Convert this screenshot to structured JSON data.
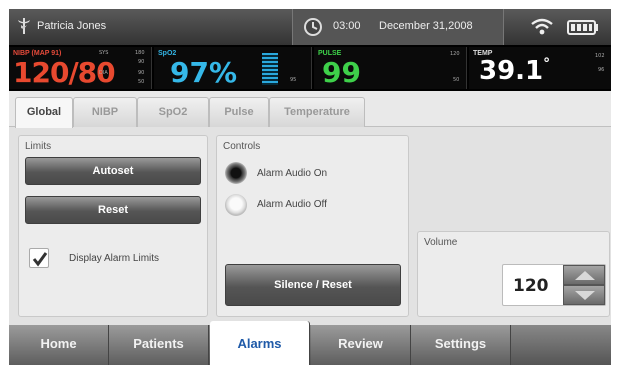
{
  "status_bar": {
    "patient_name": "Patricia Jones",
    "time": "03:00",
    "date": "December 31,2008",
    "icons": [
      "caduceus-icon",
      "clock-icon",
      "wifi-icon",
      "battery-icon"
    ]
  },
  "vitals": {
    "nibp": {
      "label": "NIBP (MAP 91)",
      "value": "120/80",
      "sys": "SYS",
      "dia": "DIA",
      "sys_hi": "180",
      "sys_lo": "90",
      "dia_hi": "90",
      "dia_lo": "50"
    },
    "spo2": {
      "label": "SpO2",
      "value": "97%",
      "limit_low": "95"
    },
    "pulse": {
      "label": "PULSE",
      "value": "99",
      "limit_high": "120",
      "limit_low": "50"
    },
    "temp": {
      "label": "TEMP",
      "value": "39.1",
      "unit": "°",
      "limit_high": "102",
      "limit_low": "96"
    },
    "colors": {
      "nibp": "#e8492f",
      "spo2": "#35b8e8",
      "pulse": "#3ed04a",
      "temp": "#ffffff"
    }
  },
  "tabs": [
    {
      "label": "Global",
      "active": true
    },
    {
      "label": "NIBP"
    },
    {
      "label": "SpO2"
    },
    {
      "label": "Pulse"
    },
    {
      "label": "Temperature"
    }
  ],
  "limits": {
    "title": "Limits",
    "autoset_label": "Autoset",
    "reset_label": "Reset",
    "display_alarm_limits_label": "Display Alarm Limits",
    "display_alarm_limits_checked": true
  },
  "controls": {
    "title": "Controls",
    "alarm_audio_on_label": "Alarm Audio On",
    "alarm_audio_off_label": "Alarm Audio Off",
    "selected": "Alarm Audio On",
    "silence_reset_label": "Silence / Reset"
  },
  "volume": {
    "title": "Volume",
    "value": "120"
  },
  "nav": {
    "items": [
      {
        "label": "Home"
      },
      {
        "label": "Patients"
      },
      {
        "label": "Alarms",
        "active": true
      },
      {
        "label": "Review"
      },
      {
        "label": "Settings"
      }
    ],
    "active_color": "#1f5aa8"
  }
}
